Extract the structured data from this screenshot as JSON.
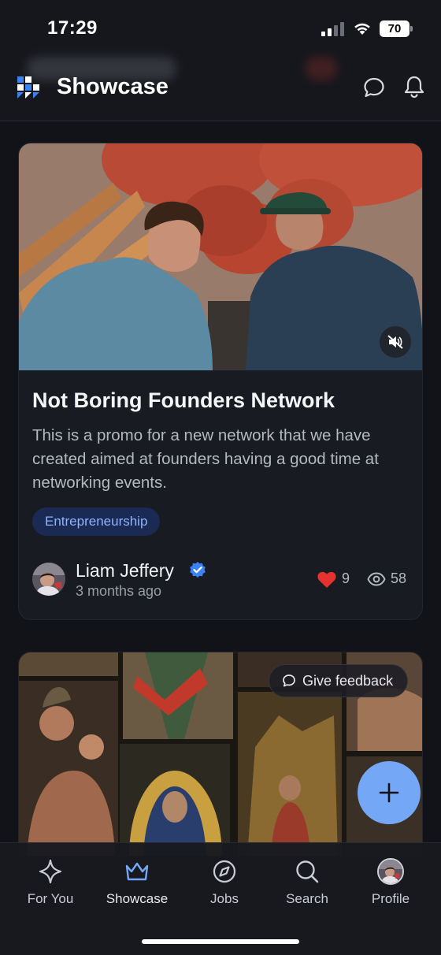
{
  "status_bar": {
    "time": "17:29",
    "battery": "70"
  },
  "header": {
    "title": "Showcase"
  },
  "posts": [
    {
      "title": "Not Boring Founders Network",
      "description": "This is a promo for a new network that we have created aimed at founders having a good time at networking events.",
      "tag": "Entrepreneurship",
      "author": {
        "name": "Liam Jeffery",
        "verified": true,
        "time": "3 months ago"
      },
      "likes": "9",
      "views": "58"
    }
  ],
  "feedback": {
    "label": "Give feedback"
  },
  "nav": {
    "items": [
      {
        "label": "For You",
        "icon": "sparkle-icon"
      },
      {
        "label": "Showcase",
        "icon": "crown-icon",
        "active": true
      },
      {
        "label": "Jobs",
        "icon": "compass-icon"
      },
      {
        "label": "Search",
        "icon": "search-icon"
      },
      {
        "label": "Profile",
        "icon": "avatar"
      }
    ]
  },
  "colors": {
    "accent": "#74a8f7",
    "like": "#e5322e",
    "tag_bg": "#1a2a52",
    "tag_text": "#8fb3ff",
    "background": "#111318"
  }
}
